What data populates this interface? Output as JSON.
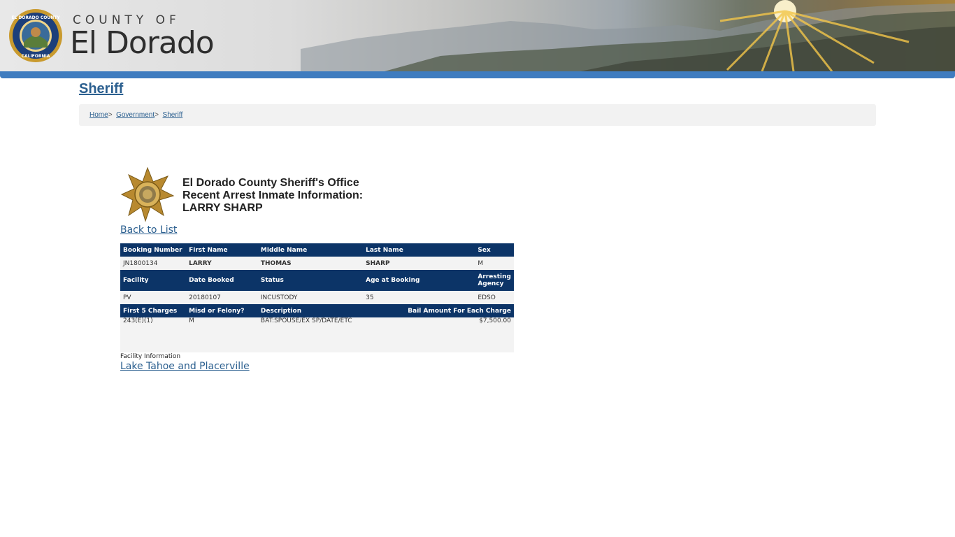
{
  "banner": {
    "county_of": "COUNTY OF",
    "county_name": "El Dorado"
  },
  "page": {
    "title": "Sheriff"
  },
  "breadcrumb": {
    "home": "Home",
    "sep1": ">",
    "government": "Government",
    "sep2": ">",
    "sheriff": "Sheriff"
  },
  "heading": {
    "line1": "El Dorado County Sheriff's Office",
    "line2": "Recent Arrest Inmate Information:",
    "line3": "LARRY SHARP"
  },
  "back_link": "Back to List",
  "table": {
    "header1": [
      "Booking Number",
      "First Name",
      "Middle Name",
      "Last Name",
      "Sex"
    ],
    "row1": [
      "JN1800134",
      "LARRY",
      "THOMAS",
      "SHARP",
      "M"
    ],
    "header2": [
      "Facility",
      "Date Booked",
      "Status",
      "Age at Booking",
      "Arresting Agency"
    ],
    "row2": [
      "PV",
      "20180107",
      "INCUSTODY",
      "35",
      "EDSO"
    ],
    "header3": [
      "First 5 Charges",
      "Misd or Felony?",
      "Description",
      "Bail Amount For Each Charge"
    ],
    "charges": [
      {
        "code": "243(E)(1)",
        "type": "M",
        "description": "BAT:SPOUSE/EX SP/DATE/ETC",
        "bail": "$7,500.00"
      }
    ]
  },
  "facility": {
    "label": "Facility Information",
    "link": "Lake Tahoe and Placerville"
  },
  "colors": {
    "header_bg": "#0c3467",
    "link": "#2b5f8f",
    "banner_stripe": "#3f7cbf"
  }
}
